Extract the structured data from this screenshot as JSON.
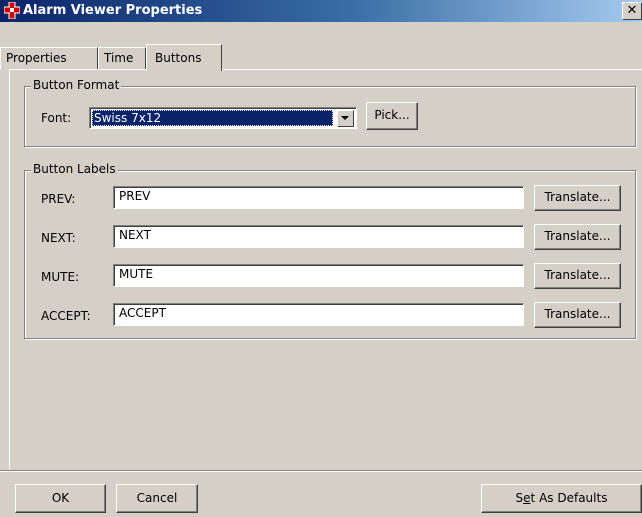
{
  "window": {
    "title": "Alarm Viewer Properties",
    "close_glyph": "✕",
    "app_icon": "alarm-viewer-icon"
  },
  "tabs": [
    {
      "label": "Properties",
      "active": false
    },
    {
      "label": "Time",
      "active": false
    },
    {
      "label": "Buttons",
      "active": true
    }
  ],
  "button_format": {
    "legend": "Button Format",
    "font_label": "Font:",
    "font_value": "Swiss 7x12",
    "pick_label": "Pick..."
  },
  "button_labels": {
    "legend": "Button Labels",
    "translate_label": "Translate...",
    "rows": [
      {
        "label": "PREV:",
        "value": "PREV"
      },
      {
        "label": "NEXT:",
        "value": "NEXT"
      },
      {
        "label": "MUTE:",
        "value": "MUTE"
      },
      {
        "label": "ACCEPT:",
        "value": "ACCEPT"
      }
    ]
  },
  "footer": {
    "ok_label": "OK",
    "cancel_label": "Cancel",
    "defaults_pre": "S",
    "defaults_accel": "e",
    "defaults_post": "t As Defaults"
  },
  "colors": {
    "title_gradient_start": "#0a246a",
    "title_gradient_end": "#a6caf0",
    "selection": "#0a246a",
    "face": "#d4d0c8"
  }
}
